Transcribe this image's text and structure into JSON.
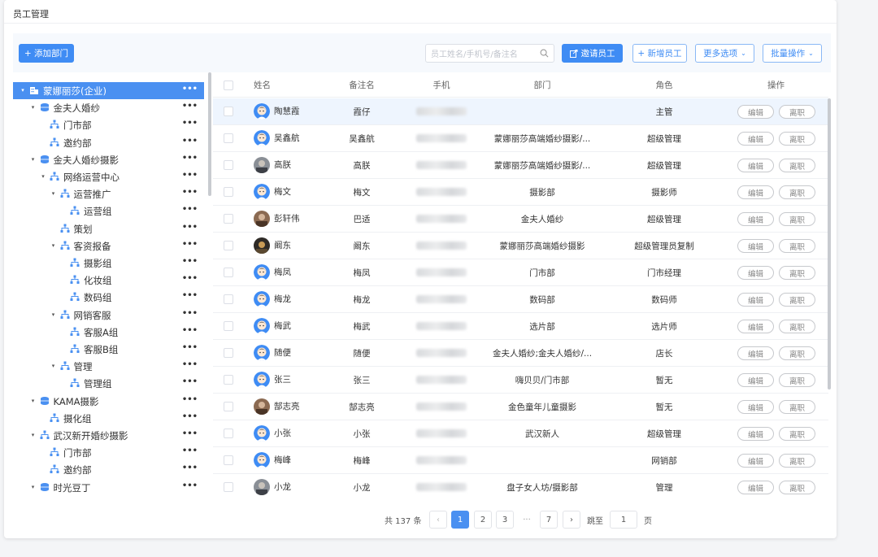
{
  "page": {
    "title": "员工管理"
  },
  "toolbar": {
    "add_dept": "+ 添加部门",
    "search_placeholder": "员工姓名/手机号/备注名",
    "invite": "邀请员工",
    "new_employee": "+ 新增员工",
    "more_options": "更多选项",
    "batch_ops": "批量操作"
  },
  "tree": [
    {
      "label": "蒙娜丽莎(企业)",
      "level": 0,
      "icon": "building-icon",
      "caret": true,
      "selected": true
    },
    {
      "label": "金夫人婚纱",
      "level": 1,
      "icon": "company-icon",
      "caret": true
    },
    {
      "label": "门市部",
      "level": 2,
      "icon": "org-icon",
      "caret": false
    },
    {
      "label": "邀约部",
      "level": 2,
      "icon": "org-icon",
      "caret": false
    },
    {
      "label": "金夫人婚纱摄影",
      "level": 1,
      "icon": "company-icon",
      "caret": true
    },
    {
      "label": "网络运营中心",
      "level": 2,
      "icon": "org-icon",
      "caret": true
    },
    {
      "label": "运营推广",
      "level": 3,
      "icon": "org-icon",
      "caret": true
    },
    {
      "label": "运营组",
      "level": 4,
      "icon": "org-icon",
      "caret": false
    },
    {
      "label": "策划",
      "level": 3,
      "icon": "org-icon",
      "caret": false
    },
    {
      "label": "客资报备",
      "level": 3,
      "icon": "org-icon",
      "caret": true
    },
    {
      "label": "摄影组",
      "level": 4,
      "icon": "org-icon",
      "caret": false
    },
    {
      "label": "化妆组",
      "level": 4,
      "icon": "org-icon",
      "caret": false
    },
    {
      "label": "数码组",
      "level": 4,
      "icon": "org-icon",
      "caret": false
    },
    {
      "label": "网销客服",
      "level": 3,
      "icon": "org-icon",
      "caret": true
    },
    {
      "label": "客服A组",
      "level": 4,
      "icon": "org-icon",
      "caret": false
    },
    {
      "label": "客服B组",
      "level": 4,
      "icon": "org-icon",
      "caret": false
    },
    {
      "label": "管理",
      "level": 3,
      "icon": "org-icon",
      "caret": true
    },
    {
      "label": "管理组",
      "level": 4,
      "icon": "org-icon",
      "caret": false
    },
    {
      "label": "KAMA摄影",
      "level": 1,
      "icon": "company-icon",
      "caret": true
    },
    {
      "label": "摄化组",
      "level": 2,
      "icon": "org-icon",
      "caret": false
    },
    {
      "label": "武汉新开婚纱摄影",
      "level": 1,
      "icon": "org-icon",
      "caret": true
    },
    {
      "label": "门市部",
      "level": 2,
      "icon": "org-icon",
      "caret": false
    },
    {
      "label": "邀约部",
      "level": 2,
      "icon": "org-icon",
      "caret": false
    },
    {
      "label": "时光豆丁",
      "level": 1,
      "icon": "company-icon",
      "caret": true
    }
  ],
  "table": {
    "headers": {
      "name": "姓名",
      "remark": "备注名",
      "phone": "手机",
      "dept": "部门",
      "role": "角色",
      "action": "操作"
    },
    "edit_label": "编辑",
    "leave_label": "离职",
    "rows": [
      {
        "name": "陶慧霞",
        "remark": "霞仔",
        "dept": "",
        "role": "主管",
        "avatar": "blue"
      },
      {
        "name": "吴鑫航",
        "remark": "吴鑫航",
        "dept": "蒙娜丽莎高端婚纱摄影/...",
        "role": "超级管理",
        "avatar": "blue"
      },
      {
        "name": "高朕",
        "remark": "高朕",
        "dept": "蒙娜丽莎高端婚纱摄影/...",
        "role": "超级管理",
        "avatar": "photo-gray"
      },
      {
        "name": "梅文",
        "remark": "梅文",
        "dept": "摄影部",
        "role": "摄影师",
        "avatar": "blue"
      },
      {
        "name": "彭轩伟",
        "remark": "巴适",
        "dept": "金夫人婚纱",
        "role": "超级管理",
        "avatar": "photo-brown"
      },
      {
        "name": "阚东",
        "remark": "阚东",
        "dept": "蒙娜丽莎高端婚纱摄影",
        "role": "超级管理员复制",
        "avatar": "photo-dark"
      },
      {
        "name": "梅凤",
        "remark": "梅凤",
        "dept": "门市部",
        "role": "门市经理",
        "avatar": "blue"
      },
      {
        "name": "梅龙",
        "remark": "梅龙",
        "dept": "数码部",
        "role": "数码师",
        "avatar": "blue"
      },
      {
        "name": "梅武",
        "remark": "梅武",
        "dept": "选片部",
        "role": "选片师",
        "avatar": "blue"
      },
      {
        "name": "随便",
        "remark": "随便",
        "dept": "金夫人婚纱;金夫人婚纱/...",
        "role": "店长",
        "avatar": "blue"
      },
      {
        "name": "张三",
        "remark": "张三",
        "dept": "嗨贝贝/门市部",
        "role": "暂无",
        "avatar": "blue"
      },
      {
        "name": "郜志亮",
        "remark": "郜志亮",
        "dept": "金色童年儿童摄影",
        "role": "暂无",
        "avatar": "photo-brown"
      },
      {
        "name": "小张",
        "remark": "小张",
        "dept": "武汉新人",
        "role": "超级管理",
        "avatar": "blue"
      },
      {
        "name": "梅峰",
        "remark": "梅峰",
        "dept": "",
        "role": "网销部",
        "avatar": "blue"
      },
      {
        "name": "小龙",
        "remark": "小龙",
        "dept": "盘子女人坊/摄影部",
        "role": "管理",
        "avatar": "photo-gray"
      }
    ]
  },
  "pagination": {
    "total": "共 137 条",
    "pages": [
      "1",
      "2",
      "3",
      "···",
      "7"
    ],
    "current": "1",
    "jump_label": "跳至",
    "jump_value": "1",
    "page_suffix": "页"
  },
  "colors": {
    "primary": "#3f8cf4",
    "selected_row": "#4a90f1"
  }
}
